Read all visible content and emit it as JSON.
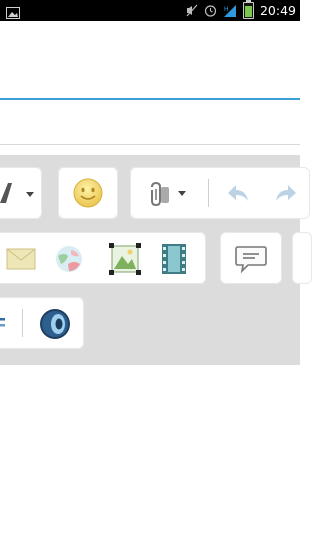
{
  "status_bar": {
    "time": "20:49",
    "icons": [
      "image-icon",
      "mute-icon",
      "alarm-icon",
      "signal-icon",
      "battery-icon"
    ],
    "battery_color": "#7cc64b"
  },
  "composer": {
    "accent_color": "#3aa0d5"
  },
  "toolbar": {
    "row1": [
      "font-style-icon",
      "smiley-icon",
      "attach-icon",
      "undo-icon",
      "redo-icon"
    ],
    "row2": [
      "email-icon",
      "globe-icon",
      "image-icon",
      "video-icon",
      "comment-icon"
    ],
    "row3": [
      "list-icon",
      "audio-icon"
    ]
  }
}
